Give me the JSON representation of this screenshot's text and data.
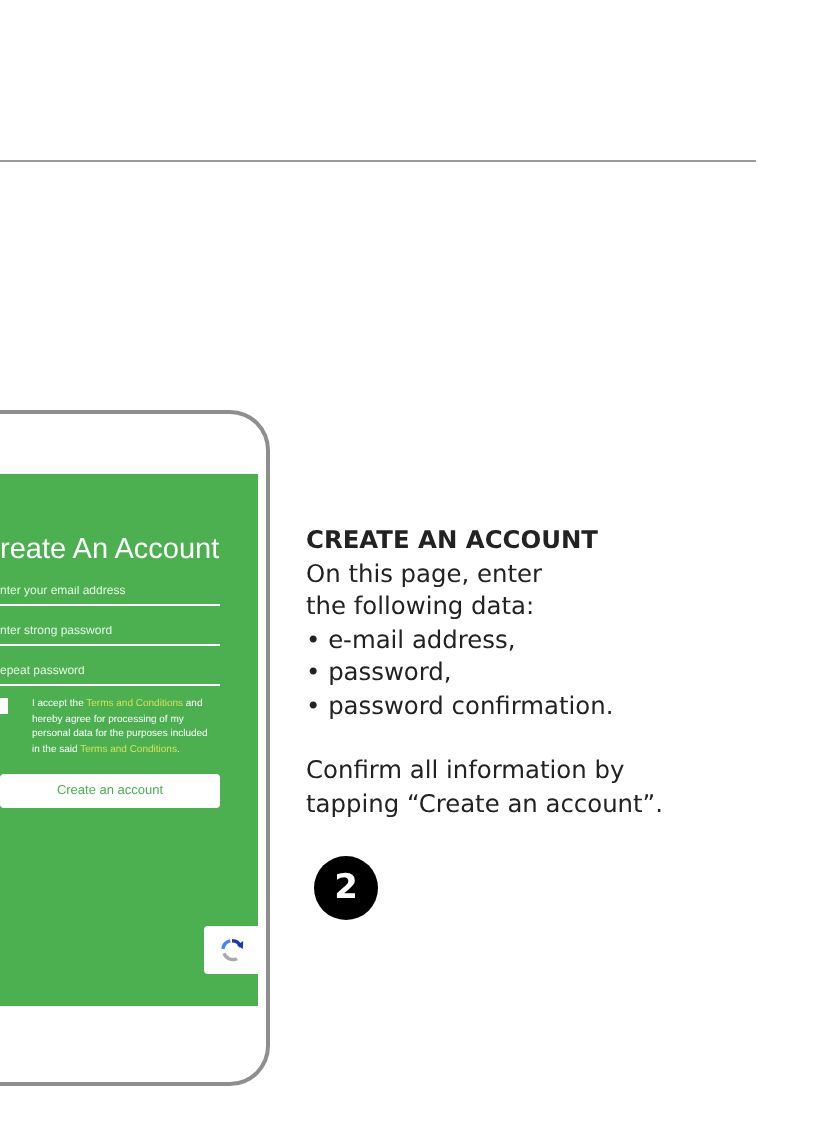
{
  "phone_screen": {
    "title": "reate An Account",
    "fields": [
      {
        "placeholder": "nter your email address"
      },
      {
        "placeholder": "nter strong password"
      },
      {
        "placeholder": "epeat password"
      }
    ],
    "consent": {
      "checked": false,
      "parts": [
        {
          "kind": "text",
          "text": "I accept the "
        },
        {
          "kind": "link",
          "text": "Terms and Conditions"
        },
        {
          "kind": "text",
          "text": " and hereby agree for processing of my personal data for the purposes included in the said "
        },
        {
          "kind": "link",
          "text": "Terms and Conditions"
        },
        {
          "kind": "text",
          "text": "."
        }
      ]
    },
    "button": "Create an account"
  },
  "instructions": {
    "heading": "CREATE AN ACCOUNT",
    "intro": "On this page, enter\nthe following data:",
    "bullets": [
      "• e-mail address,",
      "• password,",
      "• password confirmation."
    ],
    "confirm": "Confirm all information by\ntapping “Create an account”.",
    "step": "2"
  }
}
